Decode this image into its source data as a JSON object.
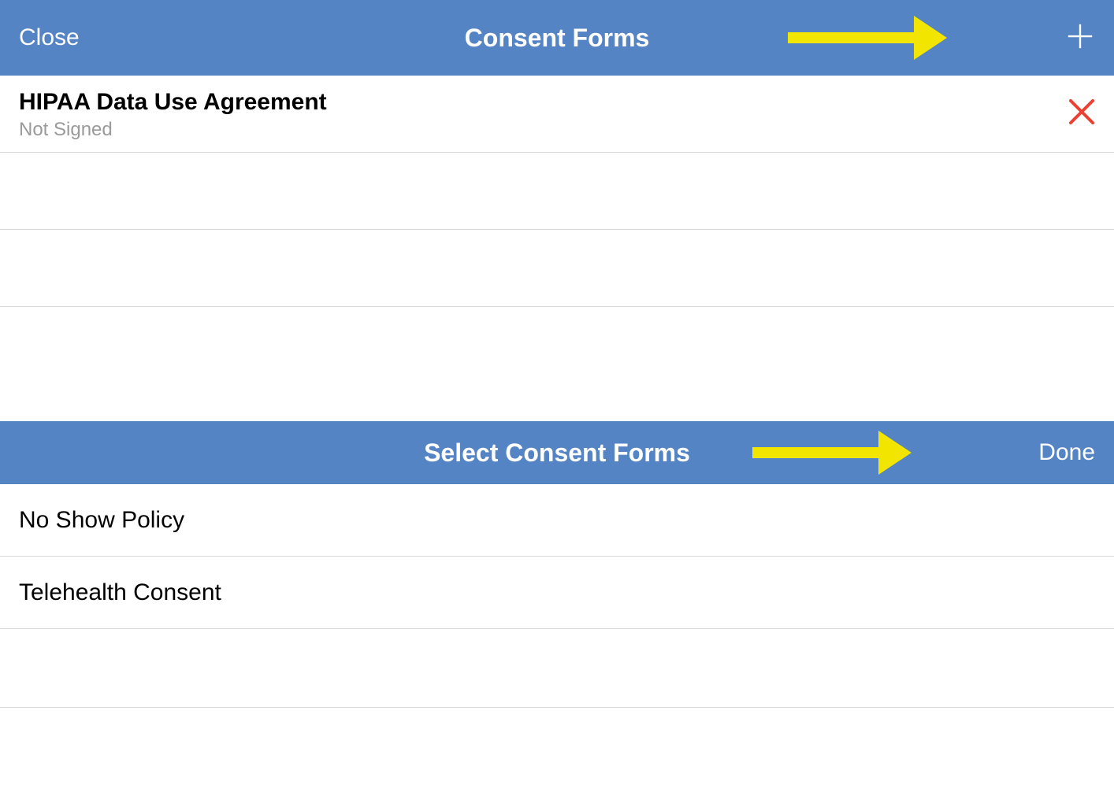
{
  "colors": {
    "headerBg": "#5584c4",
    "headerText": "#ffffff",
    "danger": "#eb4132",
    "annotation": "#f2e500"
  },
  "panel1": {
    "header": {
      "close_label": "Close",
      "title": "Consent Forms",
      "add_icon": "plus-icon"
    },
    "rows": [
      {
        "title": "HIPAA Data Use Agreement",
        "status": "Not Signed",
        "status_icon": "x-icon"
      }
    ]
  },
  "panel2": {
    "header": {
      "title": "Select Consent Forms",
      "done_label": "Done"
    },
    "rows": [
      {
        "title": "No Show Policy"
      },
      {
        "title": "Telehealth Consent"
      }
    ]
  }
}
